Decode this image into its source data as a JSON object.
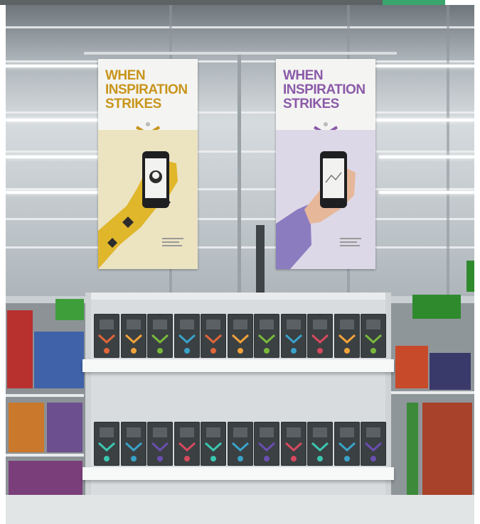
{
  "banners": [
    {
      "headline": "WHEN\nINSPIRATION\nSTRIKES",
      "color": "#c8951b"
    },
    {
      "headline": "WHEN\nINSPIRATION\nSTRIKES",
      "color": "#8a5aa8"
    }
  ],
  "palette": {
    "top_bar": "#5d6264",
    "top_bar_accent": "#3aa66e",
    "banner_left_photo": "#ece3c1",
    "banner_right_photo": "#dcd8e7",
    "product_box": "#3b4043",
    "accents": [
      "#e0663a",
      "#f2a33a",
      "#7ab83c",
      "#3aa2c9",
      "#d64a5e",
      "#3cc7b0",
      "#6a4fb0"
    ]
  },
  "shelf_rows": [
    {
      "accents": [
        "#e0663a",
        "#f2a33a",
        "#7ab83c",
        "#3aa2c9",
        "#e0663a",
        "#f2a33a",
        "#7ab83c",
        "#3aa2c9",
        "#d64a5e",
        "#f2a33a",
        "#7ab83c"
      ]
    },
    {
      "accents": [
        "#3cc7b0",
        "#3aa2c9",
        "#6a4fb0",
        "#d64a5e",
        "#3cc7b0",
        "#3aa2c9",
        "#6a4fb0",
        "#d64a5e",
        "#3cc7b0",
        "#3aa2c9",
        "#6a4fb0"
      ]
    }
  ]
}
